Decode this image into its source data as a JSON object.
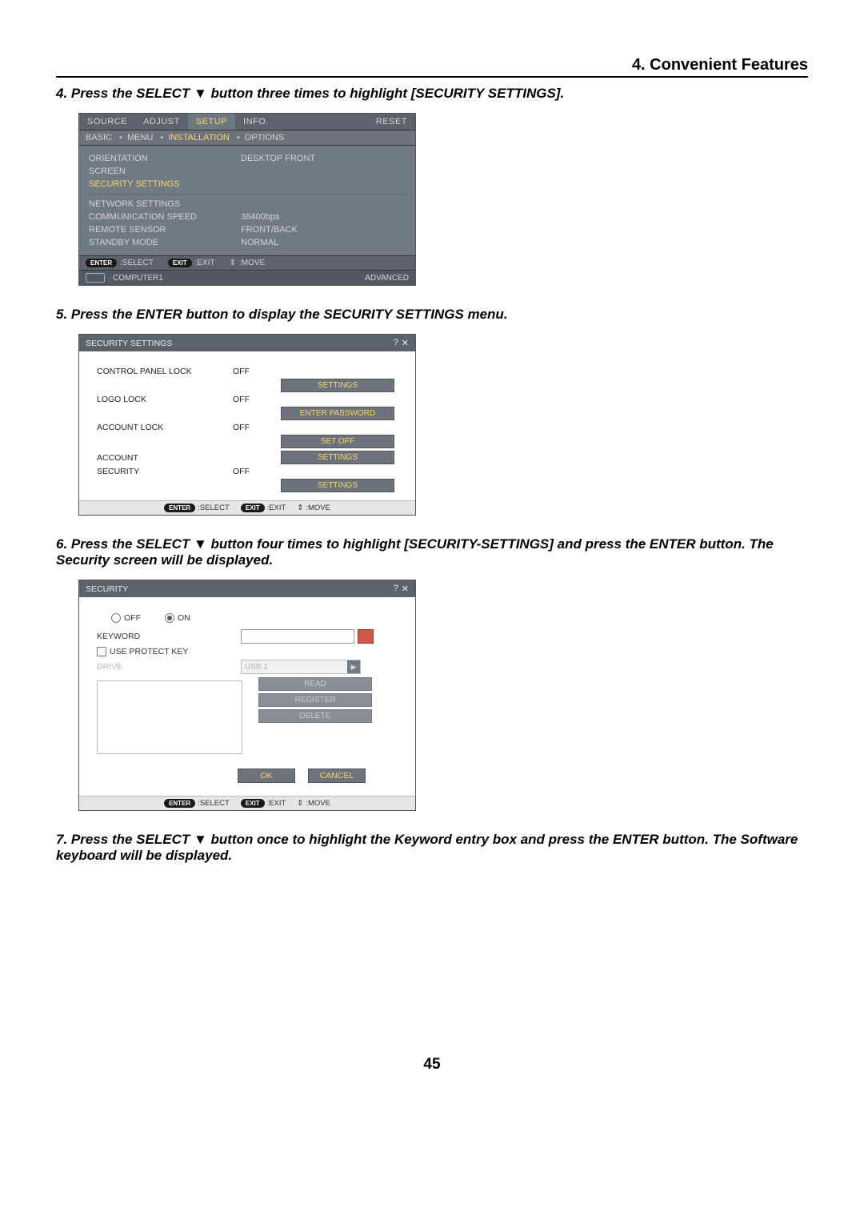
{
  "header": {
    "title": "4. Convenient Features"
  },
  "steps": {
    "s4": "4.  Press the SELECT ▼ button three times to highlight [SECURITY SETTINGS].",
    "s5": "5.  Press the ENTER button to display the SECURITY SETTINGS menu.",
    "s6": "6.  Press the SELECT ▼ button four times to highlight [SECURITY-SETTINGS] and press the ENTER button. The Security screen will be displayed.",
    "s7": "7. Press the SELECT ▼ button once to highlight the Keyword entry box and press the ENTER button. The Software keyboard will be displayed."
  },
  "osd_setup": {
    "tabs": {
      "source": "SOURCE",
      "adjust": "ADJUST",
      "setup": "SETUP",
      "info": "INFO.",
      "reset": "RESET"
    },
    "subtabs": {
      "basic": "BASIC",
      "menu": "MENU",
      "installation": "INSTALLATION",
      "options": "OPTIONS"
    },
    "rows": {
      "orientation": {
        "label": "ORIENTATION",
        "value": "DESKTOP FRONT"
      },
      "screen": {
        "label": "SCREEN",
        "value": ""
      },
      "security": {
        "label": "SECURITY SETTINGS",
        "value": ""
      },
      "network": {
        "label": "NETWORK SETTINGS",
        "value": ""
      },
      "commspeed": {
        "label": "COMMUNICATION SPEED",
        "value": "38400bps"
      },
      "remote": {
        "label": "REMOTE SENSOR",
        "value": "FRONT/BACK"
      },
      "standby": {
        "label": "STANDBY MODE",
        "value": "NORMAL"
      }
    },
    "footer": {
      "enter": "ENTER",
      "select": ":SELECT",
      "exit_pill": "EXIT",
      "exit": ":EXIT",
      "move_sym": "⇕",
      "move": ":MOVE",
      "source": "COMPUTER1",
      "mode": "ADVANCED"
    }
  },
  "sec_settings": {
    "title": "SECURITY SETTINGS",
    "rows": {
      "cpl": {
        "label": "CONTROL PANEL LOCK",
        "value": "OFF",
        "button": "SETTINGS"
      },
      "logo": {
        "label": "LOGO LOCK",
        "value": "OFF",
        "button": "ENTER PASSWORD"
      },
      "acctlock": {
        "label": "ACCOUNT LOCK",
        "value": "OFF",
        "button": "SET OFF"
      },
      "acct": {
        "label": "ACCOUNT",
        "value": "",
        "button": "SETTINGS"
      },
      "sec": {
        "label": "SECURITY",
        "value": "OFF",
        "button": "SETTINGS"
      }
    },
    "footer": {
      "enter": "ENTER",
      "select": ":SELECT",
      "exit_pill": "EXIT",
      "exit": ":EXIT",
      "move_sym": "⇕",
      "move": ":MOVE"
    }
  },
  "sec_screen": {
    "title": "SECURITY",
    "off": "OFF",
    "on": "ON",
    "keyword": "KEYWORD",
    "protect": "USE PROTECT KEY",
    "drive": "DRIVE",
    "drive_val": "USB 1",
    "read": "READ",
    "register": "REGISTER",
    "delete": "DELETE",
    "ok": "OK",
    "cancel": "CANCEL",
    "footer": {
      "enter": "ENTER",
      "select": ":SELECT",
      "exit_pill": "EXIT",
      "exit": ":EXIT",
      "move_sym": "⇕",
      "move": ":MOVE"
    }
  },
  "page_number": "45"
}
